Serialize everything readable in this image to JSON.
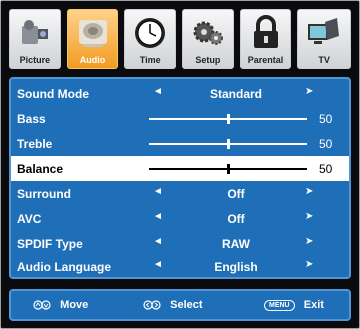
{
  "tabs": [
    {
      "label": "Picture",
      "icon": "camera-icon",
      "active": false
    },
    {
      "label": "Audio",
      "icon": "speaker-icon",
      "active": true
    },
    {
      "label": "Time",
      "icon": "clock-icon",
      "active": false
    },
    {
      "label": "Setup",
      "icon": "gear-icon",
      "active": false
    },
    {
      "label": "Parental",
      "icon": "lock-icon",
      "active": false
    },
    {
      "label": "TV",
      "icon": "tv-icon",
      "active": false
    }
  ],
  "menu": {
    "sound_mode": {
      "label": "Sound Mode",
      "value": "Standard",
      "left_arrow": "◄",
      "right_arrow": "➤"
    },
    "bass": {
      "label": "Bass",
      "value": "50",
      "level": 50
    },
    "treble": {
      "label": "Treble",
      "value": "50",
      "level": 50
    },
    "balance": {
      "label": "Balance",
      "value": "50",
      "level": 50
    },
    "surround": {
      "label": "Surround",
      "value": "Off",
      "left_arrow": "◄",
      "right_arrow": "➤"
    },
    "avc": {
      "label": "AVC",
      "value": "Off",
      "left_arrow": "◄",
      "right_arrow": "➤"
    },
    "spdif": {
      "label": "SPDIF Type",
      "value": "RAW",
      "left_arrow": "◄",
      "right_arrow": "➤"
    },
    "audio_language": {
      "label": "Audio Language",
      "value": "English",
      "left_arrow": "◄",
      "right_arrow": "➤"
    }
  },
  "footer": {
    "move_label": "Move",
    "select_label": "Select",
    "menu_key": "MENU",
    "exit_label": "Exit"
  },
  "colors": {
    "panel": "#1f6fb8",
    "active_tab": "#f29b22",
    "background": "#0b0b0d"
  }
}
